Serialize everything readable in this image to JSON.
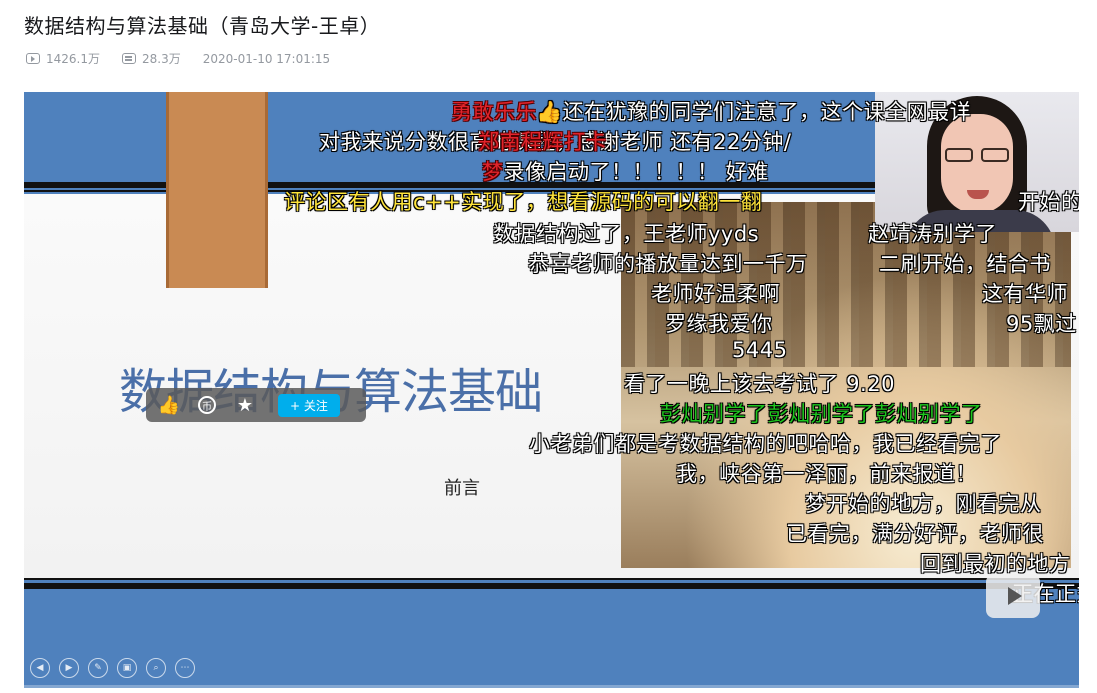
{
  "video": {
    "title": "数据结构与算法基础（青岛大学-王卓）",
    "play_count": "1426.1万",
    "danmaku_count": "28.3万",
    "publish_time": "2020-01-10 17:01:15"
  },
  "slide": {
    "title": "数据结构与算法基础",
    "subtitle": "前言"
  },
  "toolbar": {
    "like_icon": "thumb-up-icon",
    "coin_label": "币",
    "favorite_icon": "star-icon",
    "follow_label": "+ 关注"
  },
  "danmaku": [
    {
      "text": "勇敢乐乐",
      "color": "red"
    },
    {
      "text": "👍还在犹豫的同学们注意了，这个课全网最详",
      "color": "white"
    },
    {
      "text": "对我来说分数很高的课程，感谢老师  还有22分钟/",
      "color": "white"
    },
    {
      "text": "郑南程辉打卡",
      "color": "red"
    },
    {
      "text": "梦录像启动了！！！！！  好难",
      "color": "white"
    },
    {
      "text": "梦",
      "color": "red"
    },
    {
      "text": "评论区有人用c++实现了，想看源码的可以翻一翻",
      "color": "yellow"
    },
    {
      "text": "开始的",
      "color": "white"
    },
    {
      "text": "数据结构过了，王老师yyds",
      "color": "white"
    },
    {
      "text": "赵靖涛别学了",
      "color": "white"
    },
    {
      "text": "恭喜老师的播放量达到一千万",
      "color": "white"
    },
    {
      "text": "二刷开始，结合书",
      "color": "white"
    },
    {
      "text": "老师好温柔啊",
      "color": "white"
    },
    {
      "text": "这有华师",
      "color": "white"
    },
    {
      "text": "罗缘我爱你",
      "color": "white"
    },
    {
      "text": "95飘过",
      "color": "white"
    },
    {
      "text": "5445",
      "color": "white"
    },
    {
      "text": "看了一晚上该去考试了  9.20",
      "color": "white"
    },
    {
      "text": "彭灿别学了彭灿别学了彭灿别学了",
      "color": "green"
    },
    {
      "text": "小老弟们都是考数据结构的吧哈哈，我已经看完了",
      "color": "white"
    },
    {
      "text": "我，峡谷第一泽丽，前来报道！",
      "color": "white"
    },
    {
      "text": "梦开始的地方，刚看完从",
      "color": "white"
    },
    {
      "text": "已看完，满分好评，老师很",
      "color": "white"
    },
    {
      "text": "回到最初的地方",
      "color": "white"
    },
    {
      "text": "正在正式",
      "color": "white"
    }
  ],
  "controls": [
    {
      "icon": "prev-icon",
      "glyph": "◀"
    },
    {
      "icon": "next-icon",
      "glyph": "▶"
    },
    {
      "icon": "pen-icon",
      "glyph": "✎"
    },
    {
      "icon": "copy-icon",
      "glyph": "▣"
    },
    {
      "icon": "zoom-icon",
      "glyph": "⌕"
    },
    {
      "icon": "more-icon",
      "glyph": "⋯"
    }
  ]
}
